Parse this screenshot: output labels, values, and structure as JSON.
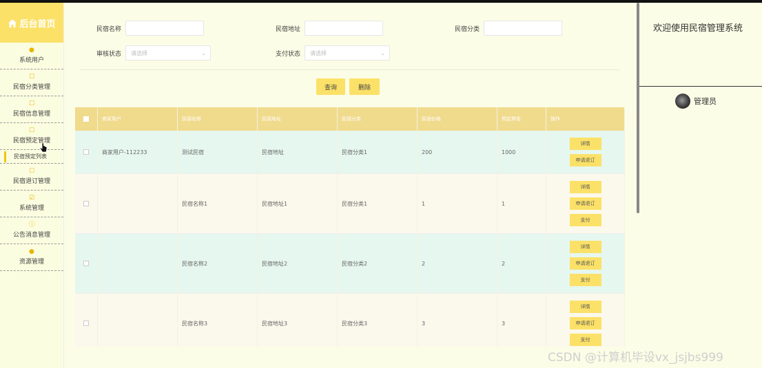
{
  "sidebar": {
    "title": "后台首页",
    "items": [
      {
        "label": "系统用户",
        "icon": "user-icon"
      },
      {
        "label": "民宿分类管理",
        "icon": "edit-icon"
      },
      {
        "label": "民宿信息管理",
        "icon": "edit-icon"
      },
      {
        "label": "民宿预定管理",
        "icon": "edit-icon"
      },
      {
        "label": "民宿退订管理",
        "icon": "edit-icon"
      },
      {
        "label": "系统管理",
        "icon": "check-icon"
      },
      {
        "label": "公告消息管理",
        "icon": "info-icon"
      },
      {
        "label": "资源管理",
        "icon": "location-icon"
      }
    ],
    "sub_item": "民宿预定列表"
  },
  "search": {
    "name_label": "民宿名称",
    "address_label": "民宿地址",
    "category_label": "民宿分类",
    "audit_label": "审核状态",
    "audit_placeholder": "请选择",
    "pay_label": "支付状态",
    "pay_placeholder": "请选择",
    "query_button": "查询",
    "delete_button": "删除"
  },
  "table": {
    "headers": [
      "商家用户",
      "民宿名称",
      "民宿地址",
      "民宿分类",
      "民宿价格",
      "预定押金",
      "操作"
    ],
    "rows": [
      {
        "merchant": "商家用户-112233",
        "name": "测试民宿",
        "address": "民宿地址",
        "category": "民宿分类1",
        "price": "200",
        "deposit": "1000",
        "actions": [
          "详情",
          "申请退订"
        ]
      },
      {
        "merchant": "",
        "name": "民宿名称1",
        "address": "民宿地址1",
        "category": "民宿分类1",
        "price": "1",
        "deposit": "1",
        "actions": [
          "详情",
          "申请退订",
          "支付"
        ]
      },
      {
        "merchant": "",
        "name": "民宿名称2",
        "address": "民宿地址2",
        "category": "民宿分类2",
        "price": "2",
        "deposit": "2",
        "actions": [
          "详情",
          "申请退订",
          "支付"
        ]
      },
      {
        "merchant": "",
        "name": "民宿名称3",
        "address": "民宿地址3",
        "category": "民宿分类3",
        "price": "3",
        "deposit": "3",
        "actions": [
          "详情",
          "申请退订",
          "支付"
        ]
      }
    ],
    "row_colors": [
      "#e6f7ef",
      "#fbf9ec",
      "#e6f7ef",
      "#fbf9ec"
    ]
  },
  "right_panel": {
    "welcome": "欢迎使用民宿管理系统",
    "user": "管理员"
  },
  "watermark": "CSDN @计算机毕设vx_jsjbs999",
  "colors": {
    "accent": "#fbe168",
    "header": "#f0da8c"
  }
}
